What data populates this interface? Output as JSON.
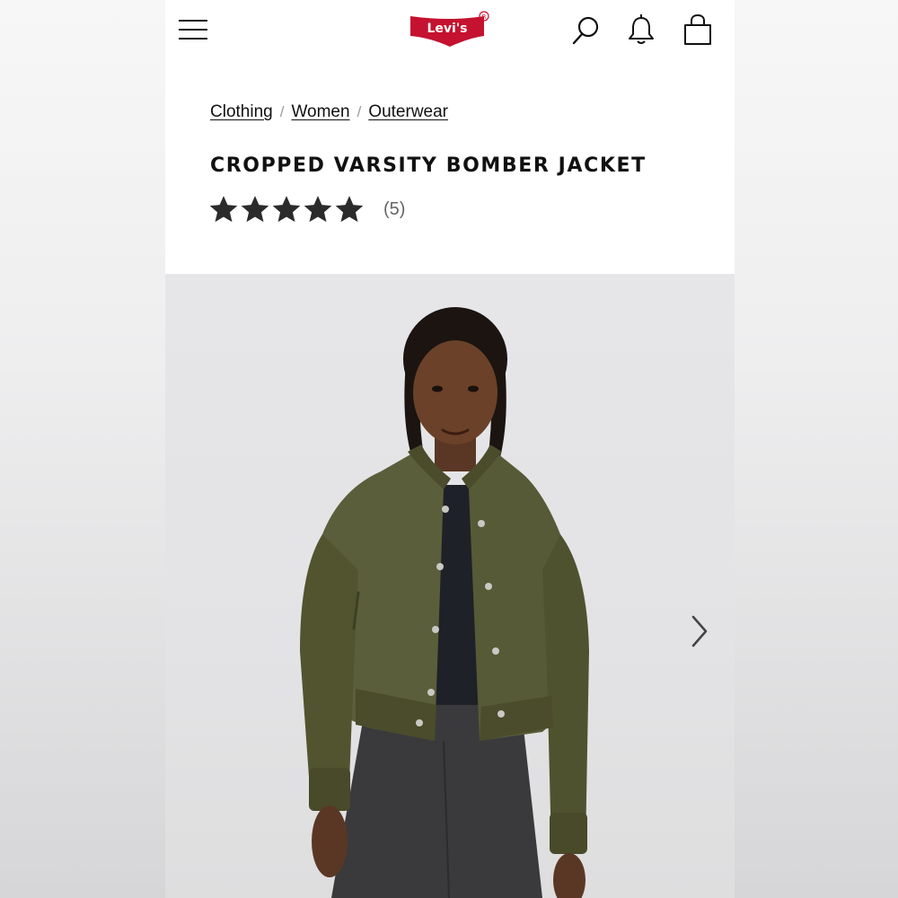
{
  "header": {
    "menu_icon": "hamburger-menu-icon",
    "logo_text": "Levi's",
    "logo_color": "#c41230",
    "search_icon": "search-icon",
    "notifications_icon": "bell-icon",
    "bag_icon": "shopping-bag-icon"
  },
  "breadcrumb": {
    "items": [
      "Clothing",
      "Women",
      "Outerwear"
    ],
    "separator": "/"
  },
  "product": {
    "title": "CROPPED VARSITY BOMBER JACKET",
    "rating": 5,
    "rating_max": 5,
    "review_count": "(5)",
    "jacket_color": "#5b5e3a"
  },
  "gallery": {
    "next_icon": "chevron-right-icon"
  }
}
